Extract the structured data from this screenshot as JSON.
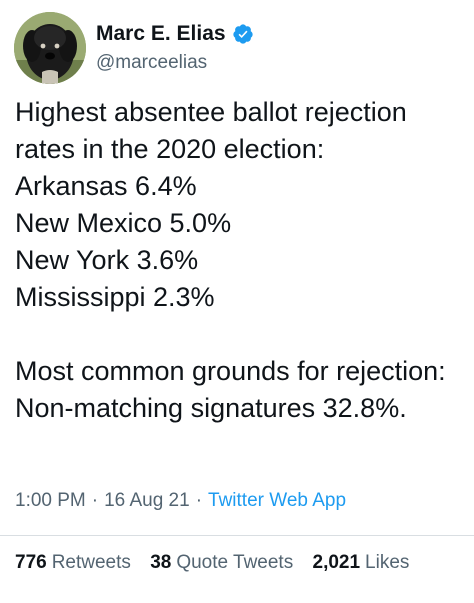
{
  "author": {
    "display_name": "Marc E. Elias",
    "handle": "@marceelias",
    "avatar_icon": "dog-avatar",
    "verified_icon": "verified-badge-icon",
    "verified_color": "#1d9bf0"
  },
  "tweet": {
    "text": "Highest absentee ballot rejection rates in the 2020 election:\nArkansas 6.4%\nNew Mexico 5.0%\nNew York 3.6%\nMississippi 2.3%\n\nMost common grounds for rejection: Non-matching signatures 32.8%."
  },
  "meta": {
    "time": "1:00 PM",
    "separator": "·",
    "date": "16 Aug 21",
    "source": "Twitter Web App"
  },
  "stats": {
    "retweets_count": "776",
    "retweets_label": "Retweets",
    "quotes_count": "38",
    "quotes_label": "Quote Tweets",
    "likes_count": "2,021",
    "likes_label": "Likes"
  },
  "colors": {
    "text": "#0f1419",
    "secondary": "#536471",
    "link": "#1d9bf0"
  }
}
